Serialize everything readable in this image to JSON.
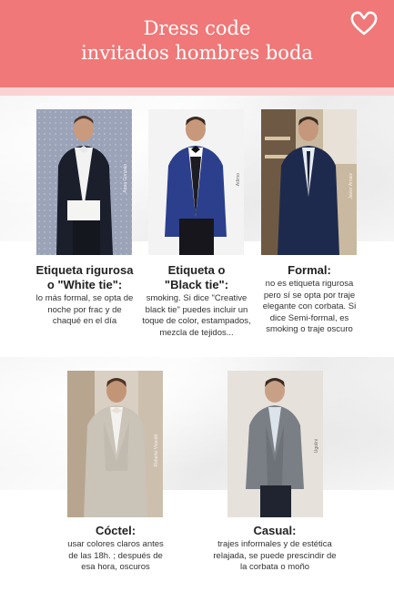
{
  "header": {
    "title_line1": "Dress code",
    "title_line2": "invitados hombres boda",
    "icon": "heart-outline-icon",
    "color": "#f07878"
  },
  "items": [
    {
      "title": "Etiqueta rigurosa o \"White tie\":",
      "description": "lo más formal, se opta de noche por frac y de chaqué en el día",
      "credit": "Anaa Gonzalo"
    },
    {
      "title": "Etiqueta o \"Black tie\":",
      "description": "smoking. Si dice \"Creative black tie\" puedes incluir un toque de color, estampados, mezcla de tejidos...",
      "credit": "Adimo"
    },
    {
      "title": "Formal:",
      "description": "no es etiqueta rigurosa pero sí se opta por traje elegante con corbata. Si dice Semi-formal, es smoking o traje oscuro",
      "credit": "Javier Arnaiz"
    },
    {
      "title": "Cóctel:",
      "description": "usar colores claros antes de las 18h. ; después de esa hora, oscuros",
      "credit": "Roberto Vicentti"
    },
    {
      "title": "Casual:",
      "description": "trajes informales y de estética relajada, se puede prescindir de la corbata o moño",
      "credit": "Ugolini"
    }
  ]
}
